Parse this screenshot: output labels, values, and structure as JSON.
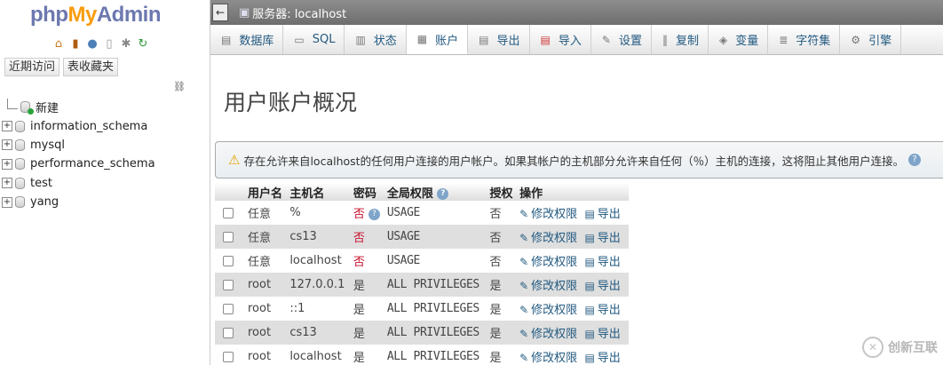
{
  "app": {
    "logo": {
      "php": "php",
      "my": "My",
      "admin": "Admin"
    },
    "nav_icons": [
      "home-icon",
      "database-icon",
      "help-icon",
      "docs-icon",
      "settings-icon",
      "reload-icon"
    ],
    "nav_tabs": [
      "近期访问",
      "表收藏夹"
    ],
    "tree": [
      {
        "label": "新建",
        "type": "new"
      },
      {
        "label": "information_schema",
        "type": "db"
      },
      {
        "label": "mysql",
        "type": "db"
      },
      {
        "label": "performance_schema",
        "type": "db"
      },
      {
        "label": "test",
        "type": "db"
      },
      {
        "label": "yang",
        "type": "db"
      }
    ]
  },
  "topbar": {
    "server_label": "服务器: localhost"
  },
  "tabs": [
    {
      "label": "数据库",
      "icon": "database-icon"
    },
    {
      "label": "SQL",
      "icon": "sql-icon"
    },
    {
      "label": "状态",
      "icon": "status-icon"
    },
    {
      "label": "账户",
      "icon": "accounts-icon",
      "active": true
    },
    {
      "label": "导出",
      "icon": "export-icon"
    },
    {
      "label": "导入",
      "icon": "import-icon"
    },
    {
      "label": "设置",
      "icon": "wrench-icon"
    },
    {
      "label": "复制",
      "icon": "replication-icon"
    },
    {
      "label": "变量",
      "icon": "variables-icon"
    },
    {
      "label": "字符集",
      "icon": "charset-icon"
    },
    {
      "label": "引擎",
      "icon": "engine-icon"
    }
  ],
  "page": {
    "title": "用户账户概况",
    "notice": "存在允许来自localhost的任何用户连接的用户帐户。如果其帐户的主机部分允许来自任何（％）主机的连接，这将阻止其他用户连接。"
  },
  "table": {
    "headers": [
      "用户名",
      "主机名",
      "密码",
      "全局权限",
      "授权",
      "操作"
    ],
    "edit_label": "修改权限",
    "export_label": "导出",
    "rows": [
      {
        "user": "任意",
        "host": "%",
        "password": "否",
        "privileges": "USAGE",
        "grant": "否"
      },
      {
        "user": "任意",
        "host": "cs13",
        "password": "否",
        "privileges": "USAGE",
        "grant": "否"
      },
      {
        "user": "任意",
        "host": "localhost",
        "password": "否",
        "privileges": "USAGE",
        "grant": "否"
      },
      {
        "user": "root",
        "host": "127.0.0.1",
        "password": "是",
        "privileges": "ALL PRIVILEGES",
        "grant": "是"
      },
      {
        "user": "root",
        "host": "::1",
        "password": "是",
        "privileges": "ALL PRIVILEGES",
        "grant": "是"
      },
      {
        "user": "root",
        "host": "cs13",
        "password": "是",
        "privileges": "ALL PRIVILEGES",
        "grant": "是"
      },
      {
        "user": "root",
        "host": "localhost",
        "password": "是",
        "privileges": "ALL PRIVILEGES",
        "grant": "是"
      }
    ]
  },
  "watermark": {
    "text": "创新互联"
  }
}
